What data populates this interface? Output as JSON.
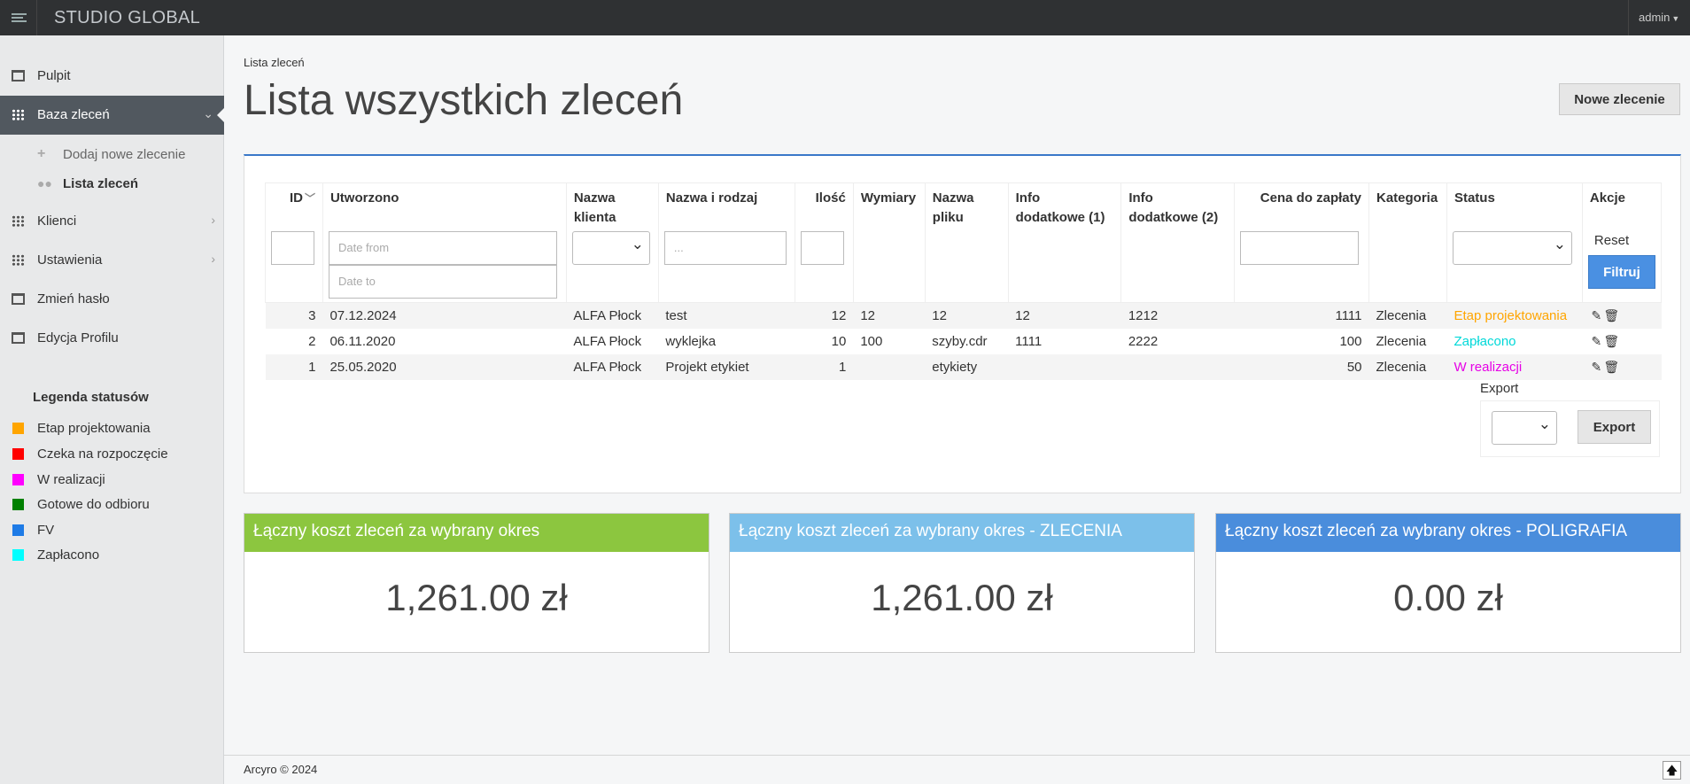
{
  "app": {
    "brand": "STUDIO GLOBAL",
    "user": "admin"
  },
  "sidebar": {
    "items": [
      {
        "label": "Pulpit"
      },
      {
        "label": "Baza zleceń"
      },
      {
        "label": "Klienci"
      },
      {
        "label": "Ustawienia"
      },
      {
        "label": "Zmień hasło"
      },
      {
        "label": "Edycja Profilu"
      }
    ],
    "subitems": [
      {
        "label": "Dodaj nowe zlecenie"
      },
      {
        "label": "Lista zleceń"
      }
    ],
    "legend_title": "Legenda statusów",
    "legend": [
      {
        "label": "Etap projektowania",
        "color": "#ffa500"
      },
      {
        "label": "Czeka na rozpoczęcie",
        "color": "#ff0000"
      },
      {
        "label": "W realizacji",
        "color": "#ff00ff"
      },
      {
        "label": "Gotowe do odbioru",
        "color": "#008000"
      },
      {
        "label": "FV",
        "color": "#1e7be6"
      },
      {
        "label": "Zapłacono",
        "color": "#00ffff"
      }
    ]
  },
  "main": {
    "breadcrumb": "Lista zleceń",
    "title": "Lista wszystkich zleceń",
    "new_button": "Nowe zlecenie"
  },
  "table": {
    "headers": {
      "id": "ID",
      "created": "Utworzono",
      "client_1": "Nazwa",
      "client_2": "klienta",
      "name": "Nazwa i rodzaj",
      "qty": "Ilość",
      "dims": "Wymiary",
      "file_1": "Nazwa",
      "file_2": "pliku",
      "info1_1": "Info",
      "info1_2": "dodatkowe (1)",
      "info2_1": "Info",
      "info2_2": "dodatkowe (2)",
      "price": "Cena do zapłaty",
      "category": "Kategoria",
      "status": "Status",
      "actions": "Akcje"
    },
    "filters": {
      "date_from": "Date from",
      "date_to": "Date to",
      "name_placeholder": "...",
      "reset": "Reset",
      "filter_button": "Filtruj"
    },
    "rows": [
      {
        "id": "3",
        "created": "07.12.2024",
        "client": "ALFA Płock",
        "name": "test",
        "qty": "12",
        "dims": "12",
        "file": "12",
        "info1": "12",
        "info2": "1212",
        "price": "1111",
        "category": "Zlecenia",
        "status": "Etap projektowania",
        "status_color": "#ffa500"
      },
      {
        "id": "2",
        "created": "06.11.2020",
        "client": "ALFA Płock",
        "name": "wyklejka",
        "qty": "10",
        "dims": "100",
        "file": "szyby.cdr",
        "info1": "1111",
        "info2": "2222",
        "price": "100",
        "category": "Zlecenia",
        "status": "Zapłacono",
        "status_color": "#00d8d8"
      },
      {
        "id": "1",
        "created": "25.05.2020",
        "client": "ALFA Płock",
        "name": "Projekt etykiet",
        "qty": "1",
        "dims": "",
        "file": "etykiety",
        "info1": "",
        "info2": "",
        "price": "50",
        "category": "Zlecenia",
        "status": "W realizacji",
        "status_color": "#e600e6"
      }
    ],
    "export_label": "Export",
    "export_button": "Export"
  },
  "stats": [
    {
      "title": "Łączny koszt zleceń za wybrany okres",
      "value": "1,261.00 zł",
      "color": "#8cc63f"
    },
    {
      "title": "Łączny koszt zleceń za wybrany okres - ZLECENIA",
      "value": "1,261.00 zł",
      "color": "#7cc0ea"
    },
    {
      "title": "Łączny koszt zleceń za wybrany okres - POLIGRAFIA",
      "value": "0.00 zł",
      "color": "#4a8ddc"
    }
  ],
  "footer": {
    "copyright": "Arcyro © 2024"
  }
}
